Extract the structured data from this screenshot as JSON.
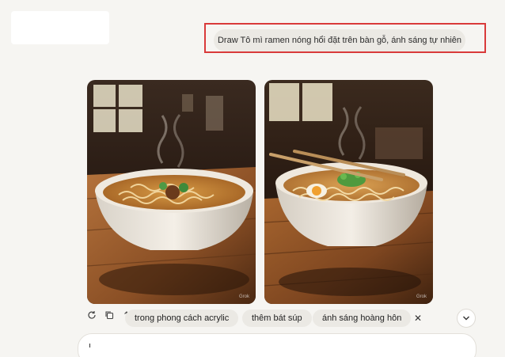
{
  "prompt": {
    "text": "Draw Tô mì ramen nóng hổi đặt trên bàn gỗ, ánh sáng tự nhiên"
  },
  "images": [
    {
      "watermark": "Grok"
    },
    {
      "watermark": "Grok"
    }
  ],
  "actions": {
    "icons": [
      "regenerate-icon",
      "copy-icon",
      "share-icon"
    ]
  },
  "suggestions": [
    "trong phong cách acrylic",
    "thêm bát súp",
    "ánh sáng hoàng hôn"
  ],
  "suggestions_close_symbol": "✕",
  "colors": {
    "background": "#f6f5f2",
    "chip": "#ebe9e4",
    "highlight": "#d93a3a"
  }
}
